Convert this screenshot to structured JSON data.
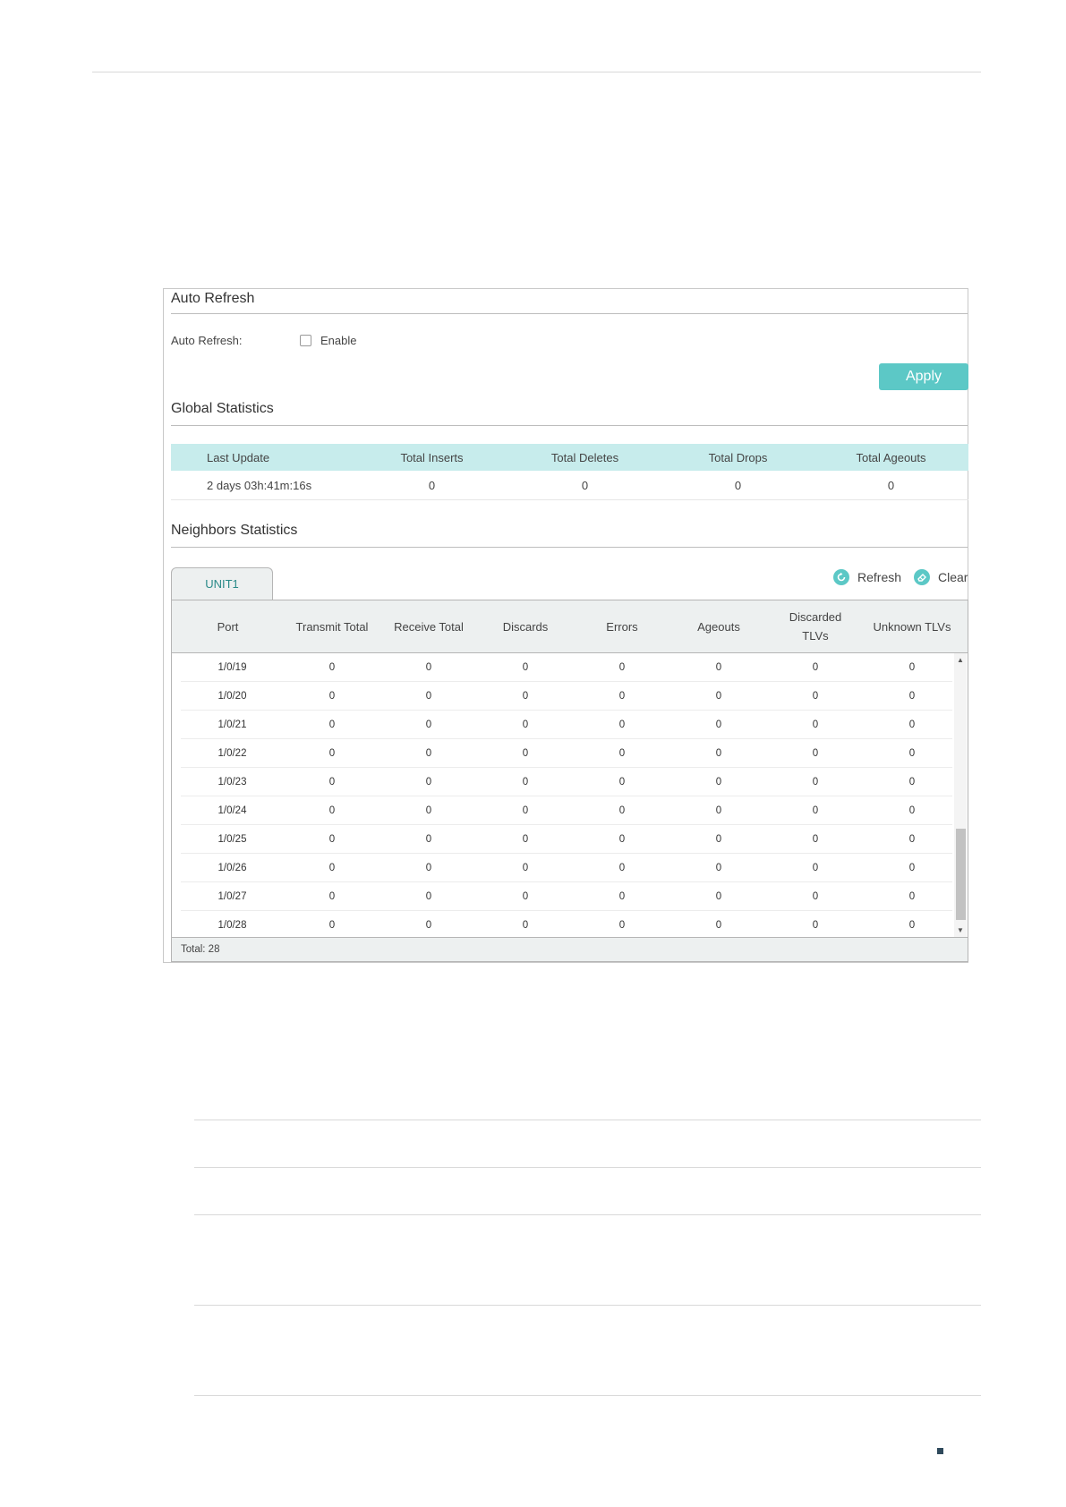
{
  "auto_refresh": {
    "section_title": "Auto Refresh",
    "label": "Auto Refresh:",
    "checkbox_label": "Enable",
    "checked": false,
    "apply_label": "Apply"
  },
  "global_statistics": {
    "section_title": "Global Statistics",
    "headers": [
      "Last Update",
      "Total Inserts",
      "Total Deletes",
      "Total Drops",
      "Total Ageouts"
    ],
    "row": [
      "2 days 03h:41m:16s",
      "0",
      "0",
      "0",
      "0"
    ]
  },
  "neighbors_statistics": {
    "section_title": "Neighbors Statistics",
    "tab_label": "UNIT1",
    "refresh_label": "Refresh",
    "clear_label": "Clear",
    "headers": [
      "Port",
      "Transmit Total",
      "Receive Total",
      "Discards",
      "Errors",
      "Ageouts",
      "Discarded TLVs",
      "Unknown TLVs"
    ],
    "rows": [
      [
        "1/0/19",
        "0",
        "0",
        "0",
        "0",
        "0",
        "0",
        "0"
      ],
      [
        "1/0/20",
        "0",
        "0",
        "0",
        "0",
        "0",
        "0",
        "0"
      ],
      [
        "1/0/21",
        "0",
        "0",
        "0",
        "0",
        "0",
        "0",
        "0"
      ],
      [
        "1/0/22",
        "0",
        "0",
        "0",
        "0",
        "0",
        "0",
        "0"
      ],
      [
        "1/0/23",
        "0",
        "0",
        "0",
        "0",
        "0",
        "0",
        "0"
      ],
      [
        "1/0/24",
        "0",
        "0",
        "0",
        "0",
        "0",
        "0",
        "0"
      ],
      [
        "1/0/25",
        "0",
        "0",
        "0",
        "0",
        "0",
        "0",
        "0"
      ],
      [
        "1/0/26",
        "0",
        "0",
        "0",
        "0",
        "0",
        "0",
        "0"
      ],
      [
        "1/0/27",
        "0",
        "0",
        "0",
        "0",
        "0",
        "0",
        "0"
      ],
      [
        "1/0/28",
        "0",
        "0",
        "0",
        "0",
        "0",
        "0",
        "0"
      ]
    ],
    "total_label": "Total: 28"
  },
  "colors": {
    "accent": "#5cc8c6",
    "header_bg": "#c7ecec",
    "table_header_bg": "#edf0f0"
  }
}
